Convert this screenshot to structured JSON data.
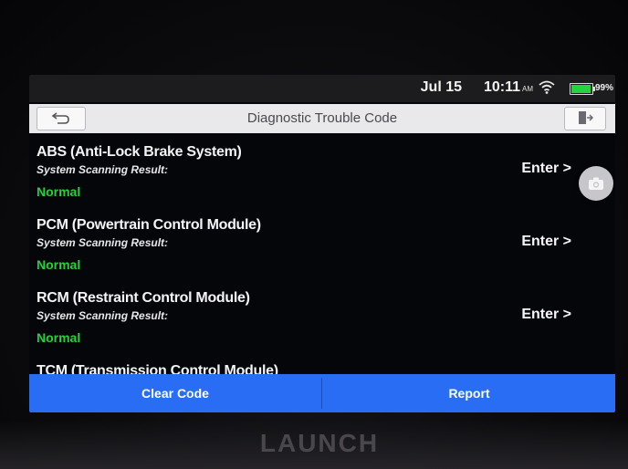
{
  "status_bar": {
    "date": "Jul 15",
    "time": "10:11",
    "ampm": "AM",
    "battery": "99%",
    "icons": [
      "wifi-icon",
      "battery-icon"
    ]
  },
  "header": {
    "title": "Diagnostic Trouble Code",
    "back_icon": "back-arrow-icon",
    "exit_icon": "exit-door-icon"
  },
  "modules": [
    {
      "name": "ABS (Anti-Lock Brake System)",
      "scan_label": "System Scanning Result:",
      "result": "Normal",
      "action": "Enter >"
    },
    {
      "name": "PCM (Powertrain Control Module)",
      "scan_label": "System Scanning Result:",
      "result": "Normal",
      "action": "Enter >"
    },
    {
      "name": "RCM (Restraint Control Module)",
      "scan_label": "System Scanning Result:",
      "result": "Normal",
      "action": "Enter >"
    },
    {
      "name": "TCM (Transmission Control Module)"
    }
  ],
  "floating": {
    "icon": "camera-icon"
  },
  "bottom_bar": {
    "clear_code": "Clear Code",
    "report": "Report"
  },
  "device": {
    "brand": "LAUNCH"
  },
  "colors": {
    "accent": "#2a6df5",
    "normal_status": "#23d13b",
    "battery": "#27d33a"
  }
}
